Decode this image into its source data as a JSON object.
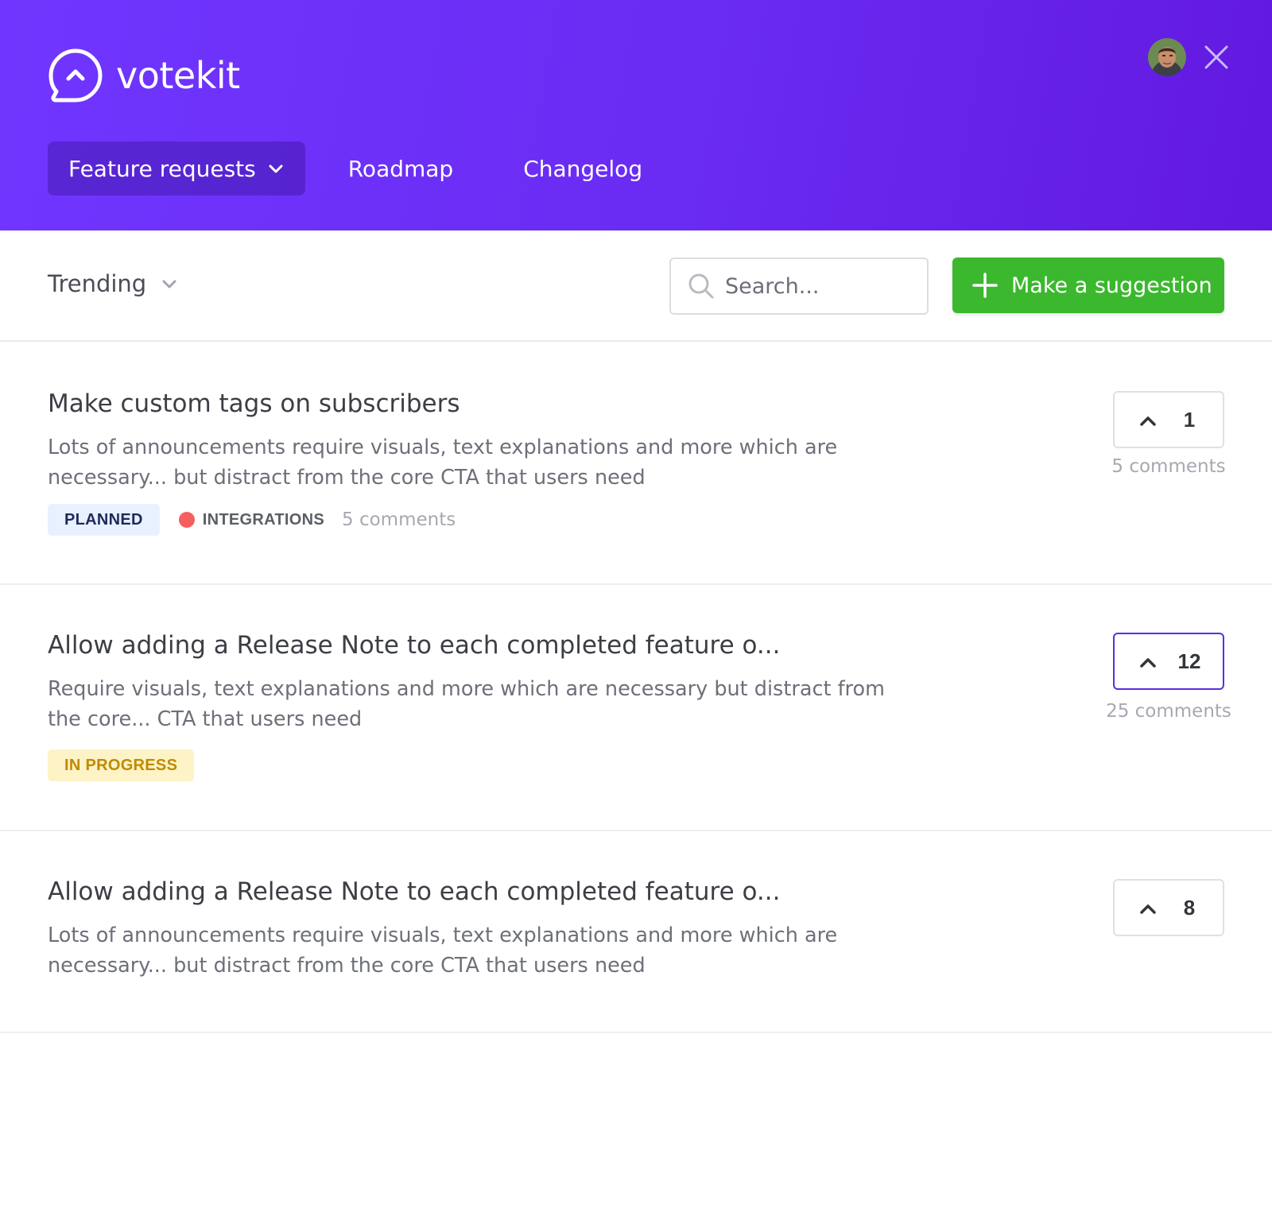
{
  "brand": {
    "name": "votekit",
    "accent": "#6d2df7",
    "success": "#3bb82e"
  },
  "header": {
    "nav": [
      {
        "label": "Feature requests",
        "active": true
      },
      {
        "label": "Roadmap",
        "active": false
      },
      {
        "label": "Changelog",
        "active": false
      }
    ],
    "icons": {
      "logo": "chat-bubble-logo-icon",
      "avatar": "user-avatar",
      "close": "close-icon"
    }
  },
  "toolbar": {
    "sort_label": "Trending",
    "search_placeholder": "Search...",
    "suggest_label": "Make a suggestion"
  },
  "posts": [
    {
      "title": "Make custom tags on subscribers",
      "description": "Lots of announcements require visuals, text explanations and more which are necessary... but distract from the core CTA that users need",
      "status": "PLANNED",
      "tag": "INTEGRATIONS",
      "tag_color": "#f55f5f",
      "meta_comments": "5 comments",
      "votes": "1",
      "vote_comments": "5 comments",
      "voted": false
    },
    {
      "title": "Allow adding a Release Note to each completed feature o...",
      "description": "Require visuals, text explanations and more which are necessary but distract from the core... CTA that users need",
      "status": "IN PROGRESS",
      "votes": "12",
      "vote_comments": "25 comments",
      "voted": true
    },
    {
      "title": "Allow adding a Release Note to each completed feature o...",
      "description": "Lots of announcements require visuals, text explanations and more which are necessary... but distract from the core CTA that users need",
      "votes": "8",
      "voted": false
    }
  ]
}
